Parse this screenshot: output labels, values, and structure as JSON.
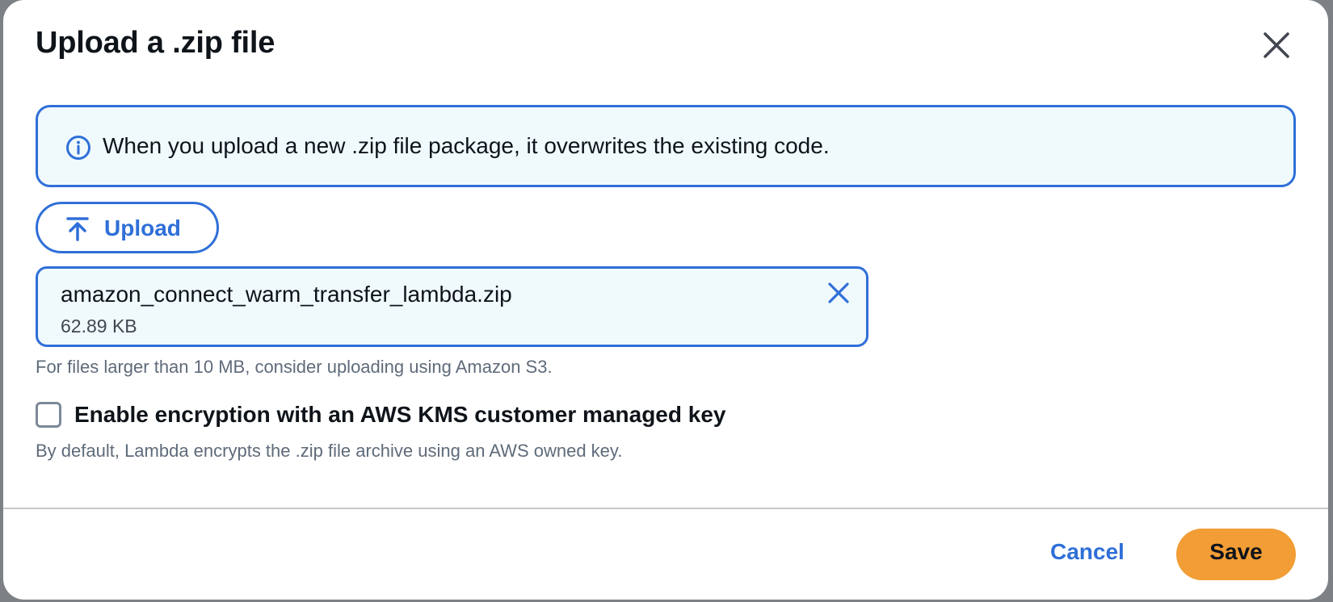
{
  "dialog": {
    "title": "Upload a .zip file",
    "close_icon": "close-icon"
  },
  "alert": {
    "icon": "info-icon",
    "text": "When you upload a new .zip file package, it overwrites the existing code."
  },
  "upload": {
    "icon": "upload-arrow-icon",
    "label": "Upload"
  },
  "file": {
    "name": "amazon_connect_warm_transfer_lambda.zip",
    "size": "62.89 KB",
    "dismiss_icon": "close-icon"
  },
  "hint": "For files larger than 10 MB, consider uploading using Amazon S3.",
  "encryption": {
    "checked": false,
    "label": "Enable encryption with an AWS KMS customer managed key",
    "description": "By default, Lambda encrypts the .zip file archive using an AWS owned key."
  },
  "footer": {
    "cancel_label": "Cancel",
    "save_label": "Save"
  },
  "colors": {
    "accent": "#2f6fd8",
    "primary_button": "#f29d35",
    "info_background": "#f0fafd"
  }
}
